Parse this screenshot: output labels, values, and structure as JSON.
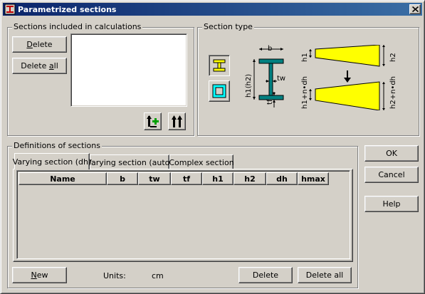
{
  "window": {
    "title": "Parametrized sections",
    "app_icon": "profile-icon",
    "close_label": "×"
  },
  "sections_group": {
    "label": "Sections included in calculations",
    "delete_label": "Delete",
    "delete_all_label": "Delete all",
    "add_button_icon": "add-section-icon",
    "add_all_button_icon": "add-all-sections-icon"
  },
  "section_type": {
    "label": "Section type",
    "i_section_icon": "i-section-icon",
    "box_section_icon": "box-section-icon",
    "diagram": {
      "b": "b",
      "tw": "tw",
      "tf": "tf",
      "h1_h2": "h1(h2)",
      "h1": "h1",
      "h2": "h2",
      "h1_ndh": "h1+n•dh",
      "h2_ndh": "h2+n•dh"
    },
    "colors": {
      "fill": "#ffff00",
      "highlight": "#00ffff",
      "arrow": "#000000"
    }
  },
  "definitions": {
    "label": "Definitions of sections",
    "tabs": [
      {
        "label": "Varying section (dh)",
        "active": true
      },
      {
        "label": "Varying section (auto)",
        "active": false
      },
      {
        "label": "Complex section",
        "active": false
      }
    ],
    "columns": [
      "Name",
      "b",
      "tw",
      "tf",
      "h1",
      "h2",
      "dh",
      "hmax"
    ],
    "rows": [],
    "new_label": "New",
    "units_label": "Units:",
    "units_value": "cm",
    "delete_label": "Delete",
    "delete_all_label": "Delete all"
  },
  "right_buttons": {
    "ok": "OK",
    "cancel": "Cancel",
    "help": "Help"
  }
}
